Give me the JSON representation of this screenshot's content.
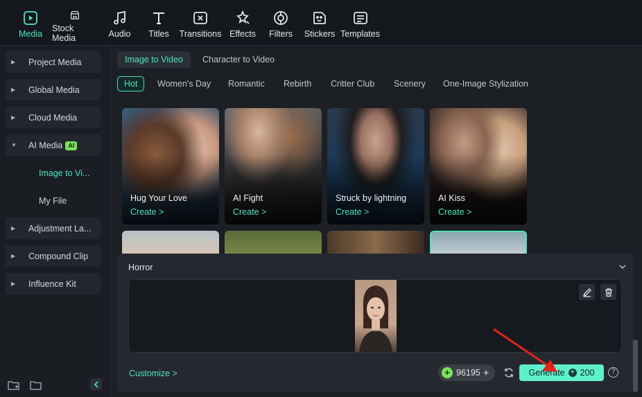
{
  "toolbar": {
    "items": [
      {
        "label": "Media",
        "icon": "media-icon"
      },
      {
        "label": "Stock Media",
        "icon": "stock-media-icon"
      },
      {
        "label": "Audio",
        "icon": "audio-icon"
      },
      {
        "label": "Titles",
        "icon": "titles-icon"
      },
      {
        "label": "Transitions",
        "icon": "transitions-icon"
      },
      {
        "label": "Effects",
        "icon": "effects-icon"
      },
      {
        "label": "Filters",
        "icon": "filters-icon"
      },
      {
        "label": "Stickers",
        "icon": "stickers-icon"
      },
      {
        "label": "Templates",
        "icon": "templates-icon"
      }
    ],
    "active": "Media"
  },
  "sidebar": {
    "items": [
      {
        "label": "Project Media"
      },
      {
        "label": "Global Media"
      },
      {
        "label": "Cloud Media"
      },
      {
        "label": "AI Media",
        "badge": "AI",
        "expanded": true
      },
      {
        "label": "Adjustment La..."
      },
      {
        "label": "Compound Clip"
      },
      {
        "label": "Influence Kit"
      }
    ],
    "sub_items": [
      {
        "label": "Image to Vi...",
        "active": true
      },
      {
        "label": "My File"
      }
    ]
  },
  "tabs": [
    {
      "label": "Image to Video",
      "active": true
    },
    {
      "label": "Character to Video"
    }
  ],
  "categories": [
    "Hot",
    "Women's Day",
    "Romantic",
    "Rebirth",
    "Critter Club",
    "Scenery",
    "One-Image Stylization"
  ],
  "cards": [
    {
      "title": "Hug Your Love",
      "cta": "Create >"
    },
    {
      "title": "AI Fight",
      "cta": "Create >"
    },
    {
      "title": "Struck by lightning",
      "cta": "Create >"
    },
    {
      "title": "AI Kiss",
      "cta": "Create >"
    }
  ],
  "panel": {
    "title": "Horror",
    "customize": "Customize >",
    "credits": "96195",
    "generate_label": "Generate",
    "generate_cost": "200"
  },
  "colors": {
    "accent": "#4fe3c2",
    "generate": "#5ef0cc",
    "badge": "#7ce35b",
    "annotation_arrow": "#e0241c"
  }
}
